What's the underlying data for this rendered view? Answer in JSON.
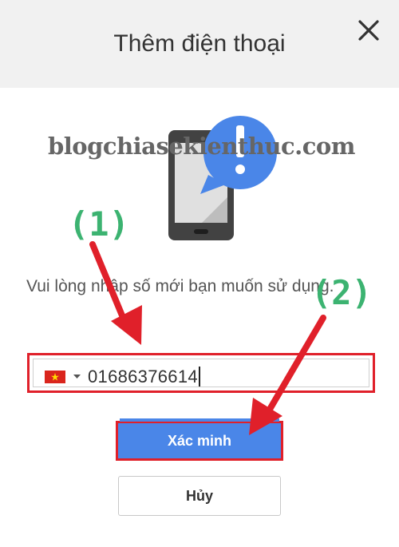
{
  "dialog": {
    "title": "Thêm điện thoại",
    "close_icon": "close-icon"
  },
  "watermark": "blogchiasekienthuc.com",
  "illustration": {
    "icon": "phone-alert-icon",
    "colors": {
      "phone": "#424242",
      "screen": "#e0e0e0",
      "bubble": "#4a86e8"
    }
  },
  "annotations": {
    "step1": "(1)",
    "step2": "(2)",
    "color": "#3cb371",
    "arrow_color": "#e0202a"
  },
  "message": "Vui lòng nhập số mới bạn muốn sử dụng.",
  "phone_input": {
    "country_icon": "vietnam-flag-icon",
    "dropdown_icon": "caret-down-icon",
    "value": "01686376614"
  },
  "buttons": {
    "verify": "Xác minh",
    "cancel": "Hủy"
  },
  "colors": {
    "primary": "#4a86e8",
    "highlight_border": "#e0202a"
  }
}
